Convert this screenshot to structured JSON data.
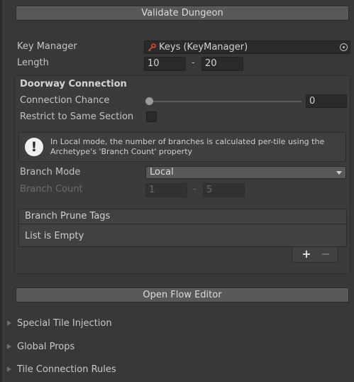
{
  "top_button": {
    "label": "Validate Dungeon"
  },
  "key_manager": {
    "label": "Key Manager",
    "value": "Keys (KeyManager)",
    "icon": "key-icon",
    "picker_icon": "object-picker-icon",
    "key_color": "#e04a3a"
  },
  "length": {
    "label": "Length",
    "min": "10",
    "max": "20",
    "separator": "-"
  },
  "doorway": {
    "header": "Doorway Connection",
    "connection_chance": {
      "label": "Connection Chance",
      "value": "0",
      "slider_fraction": 0.0
    },
    "restrict_same_section": {
      "label": "Restrict to Same Section",
      "checked": false
    },
    "help": {
      "icon": "info-icon",
      "line1": "In Local mode, the number of branches is calculated per-tile using the",
      "line2": "Archetype's 'Branch Count' property"
    },
    "branch_mode": {
      "label": "Branch Mode",
      "value": "Local"
    },
    "branch_count": {
      "label": "Branch Count",
      "min": "1",
      "max": "5",
      "separator": "-"
    },
    "prune_tags": {
      "header": "Branch Prune Tags",
      "empty_text": "List is Empty",
      "add": "+",
      "remove": "−"
    }
  },
  "flow_button": {
    "label": "Open Flow Editor"
  },
  "foldouts": [
    {
      "label": "Special Tile Injection"
    },
    {
      "label": "Global Props"
    },
    {
      "label": "Tile Connection Rules"
    }
  ]
}
